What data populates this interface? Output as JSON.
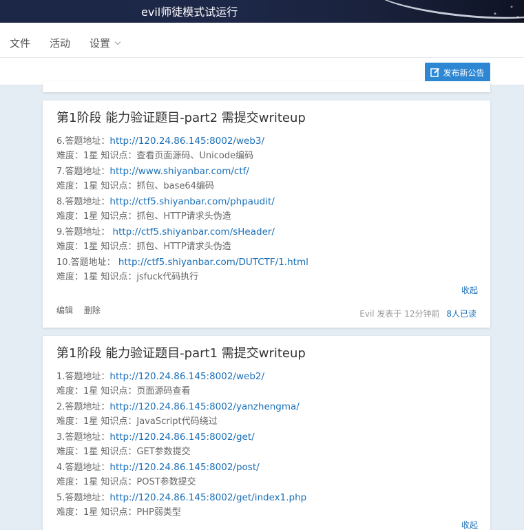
{
  "header": {
    "title": "evil师徒模式试运行"
  },
  "menu": {
    "file": "文件",
    "activity": "活动",
    "settings": "设置"
  },
  "toolbar": {
    "publish_label": "发布新公告"
  },
  "announcements": [
    {
      "title": "第1阶段 能力验证题目-part2 需提交writeup",
      "lines": [
        {
          "prefix": "6.答题地址：",
          "link": "http://120.24.86.145:8002/web3/"
        },
        {
          "text": "难度：1星 知识点：查看页面源码、Unicode编码"
        },
        {
          "prefix": "7.答题地址：",
          "link": "http://www.shiyanbar.com/ctf/"
        },
        {
          "text": "难度：1星 知识点：抓包、base64编码"
        },
        {
          "prefix": "8.答题地址：",
          "link": "http://ctf5.shiyanbar.com/phpaudit/"
        },
        {
          "text": "难度：1星 知识点：抓包、HTTP请求头伪造"
        },
        {
          "prefix": "9.答题地址： ",
          "link": "http://ctf5.shiyanbar.com/sHeader/"
        },
        {
          "text": "难度：1星 知识点：抓包、HTTP请求头伪造"
        },
        {
          "prefix": "10.答题地址： ",
          "link": "http://ctf5.shiyanbar.com/DUTCTF/1.html"
        },
        {
          "text": "难度：1星 知识点：jsfuck代码执行"
        }
      ],
      "collapse_label": "收起",
      "edit_label": "编辑",
      "delete_label": "删除",
      "meta": "Evil 发表于 12分钟前",
      "read_count": "8人已读"
    },
    {
      "title": "第1阶段 能力验证题目-part1 需提交writeup",
      "lines": [
        {
          "prefix": "1.答题地址：",
          "link": "http://120.24.86.145:8002/web2/"
        },
        {
          "text": "难度：1星 知识点：页面源码查看"
        },
        {
          "prefix": "2.答题地址：",
          "link": "http://120.24.86.145:8002/yanzhengma/"
        },
        {
          "text": "难度：1星 知识点：JavaScript代码绕过"
        },
        {
          "prefix": "3.答题地址：",
          "link": "http://120.24.86.145:8002/get/"
        },
        {
          "text": "难度：1星 知识点：GET参数提交"
        },
        {
          "prefix": "4.答题地址：",
          "link": "http://120.24.86.145:8002/post/"
        },
        {
          "text": "难度：1星 知识点：POST参数提交"
        },
        {
          "prefix": "5.答题地址：",
          "link": "http://120.24.86.145:8002/get/index1.php"
        },
        {
          "text": "难度：1星 知识点：PHP弱类型"
        }
      ],
      "collapse_label": "收起"
    }
  ],
  "colors": {
    "accent": "#2d87d3",
    "link": "#1a6fb8",
    "background": "#e4ecf4",
    "header_bg": "#1c2646"
  }
}
